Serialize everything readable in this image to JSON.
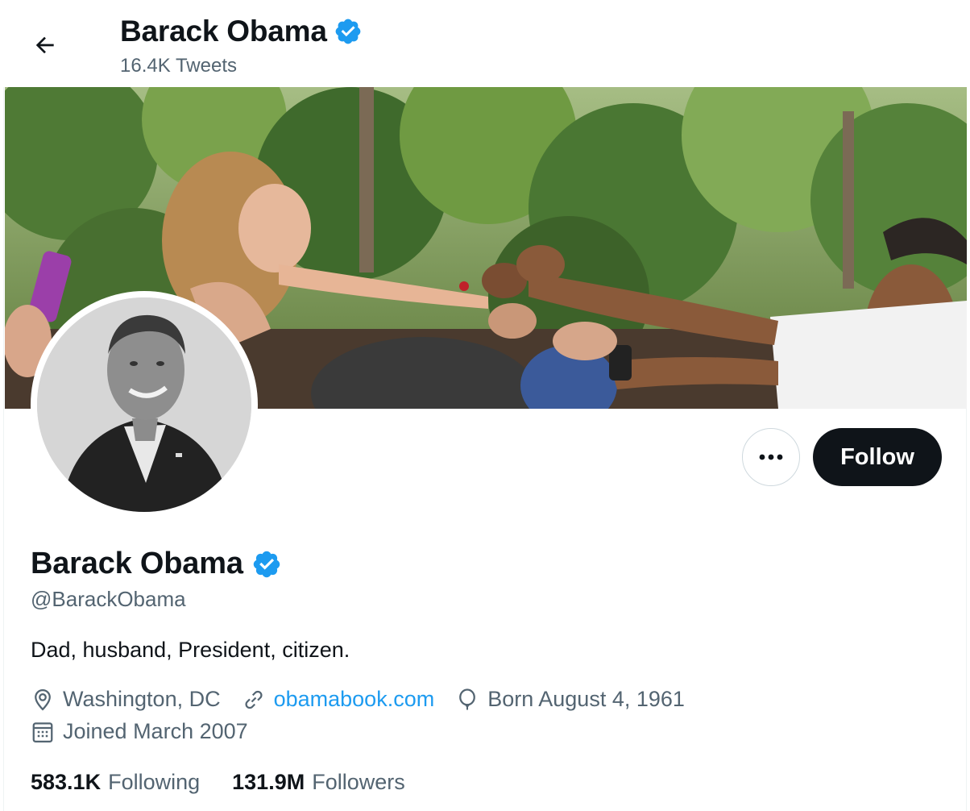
{
  "header": {
    "name": "Barack Obama",
    "tweet_count": "16.4K Tweets"
  },
  "profile": {
    "name": "Barack Obama",
    "handle": "@BarackObama",
    "bio": "Dad, husband, President, citizen.",
    "location": "Washington, DC",
    "website": "obamabook.com",
    "birthday": "Born August 4, 1961",
    "joined": "Joined March 2007",
    "verified": true
  },
  "actions": {
    "more_label": "•••",
    "follow_label": "Follow"
  },
  "stats": {
    "following_count": "583.1K",
    "following_label": "Following",
    "followers_count": "131.9M",
    "followers_label": "Followers"
  },
  "colors": {
    "accent": "#1d9bf0",
    "text_primary": "#0f1419",
    "text_secondary": "#536471",
    "follow_bg": "#0f1419"
  },
  "icons": [
    "back-arrow-icon",
    "verified-badge-icon",
    "more-icon",
    "location-icon",
    "link-icon",
    "birthday-balloon-icon",
    "calendar-icon"
  ]
}
